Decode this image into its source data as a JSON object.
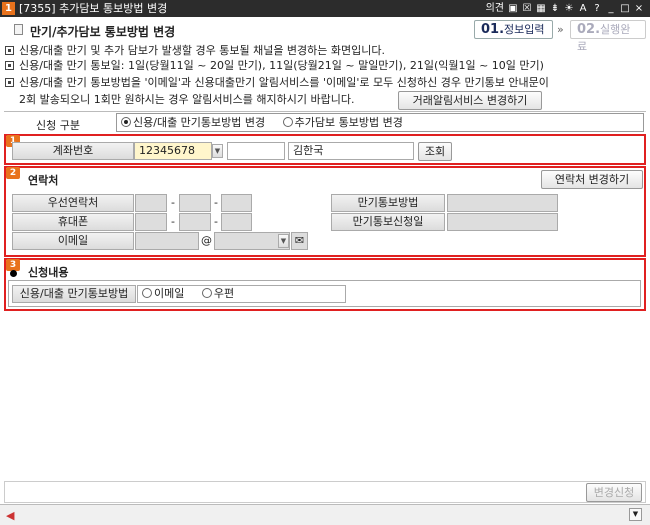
{
  "window": {
    "app_number": "1",
    "title": "[7355] 추가담보 통보방법 변경",
    "tools": [
      "의견",
      "▣",
      "☒",
      "▦",
      "⇟",
      "☀",
      "A",
      "?",
      "_",
      "□",
      "×"
    ]
  },
  "header": {
    "page_title": "만기/추가담보 통보방법 변경",
    "step1_num": "01.",
    "step1_label": "정보입력",
    "step_arrow": "»",
    "step2_num": "02.",
    "step2_label": "실행완료"
  },
  "notices": [
    "신용/대출 만기 및 추가 담보가 발생할 경우 통보될 채널을 변경하는 화면입니다.",
    "신용/대출 만기 통보일: 1일(당월11일 ~ 20일 만기), 11일(당월21일 ~ 말일만기), 21일(익월1일 ~ 10일 만기)",
    "신용/대출 만기 통보방법을 '이메일'과 신용대출만기 알림서비스를 '이메일'로 모두 신청하신 경우 만기통보 안내문이",
    "2회 발송되오니 1회만 원하시는 경우 알림서비스를 해지하시기 바랍니다."
  ],
  "alert_service_button": "거래알림서비스 변경하기",
  "request_type": {
    "label": "신청 구분",
    "option1": "신용/대출 만기통보방법 변경",
    "option2": "추가담보 통보방법 변경",
    "selected": "option1"
  },
  "section1": {
    "num": "1",
    "account_label": "계좌번호",
    "account_value": "12345678",
    "account_extra": "",
    "owner_name": "김한국",
    "lookup_button": "조회"
  },
  "section2": {
    "num": "2",
    "title": "연락처",
    "change_contact_button": "연락처 변경하기",
    "primary_contact_label": "우선연락처",
    "mobile_label": "휴대폰",
    "email_label": "이메일",
    "at_sign": "@",
    "dash": "-",
    "maturity_method_label": "만기통보방법",
    "maturity_method_value": "",
    "maturity_date_label": "만기통보신청일",
    "maturity_date_value": ""
  },
  "section3": {
    "num": "3",
    "title": "신청내용",
    "method_label": "신용/대출 만기통보방법",
    "option_email": "이메일",
    "option_post": "우편"
  },
  "submit_button": "변경신청",
  "accent_colors": {
    "section_border": "#e02020",
    "badge": "#e8721c",
    "account_highlight": "#fff6cc"
  }
}
